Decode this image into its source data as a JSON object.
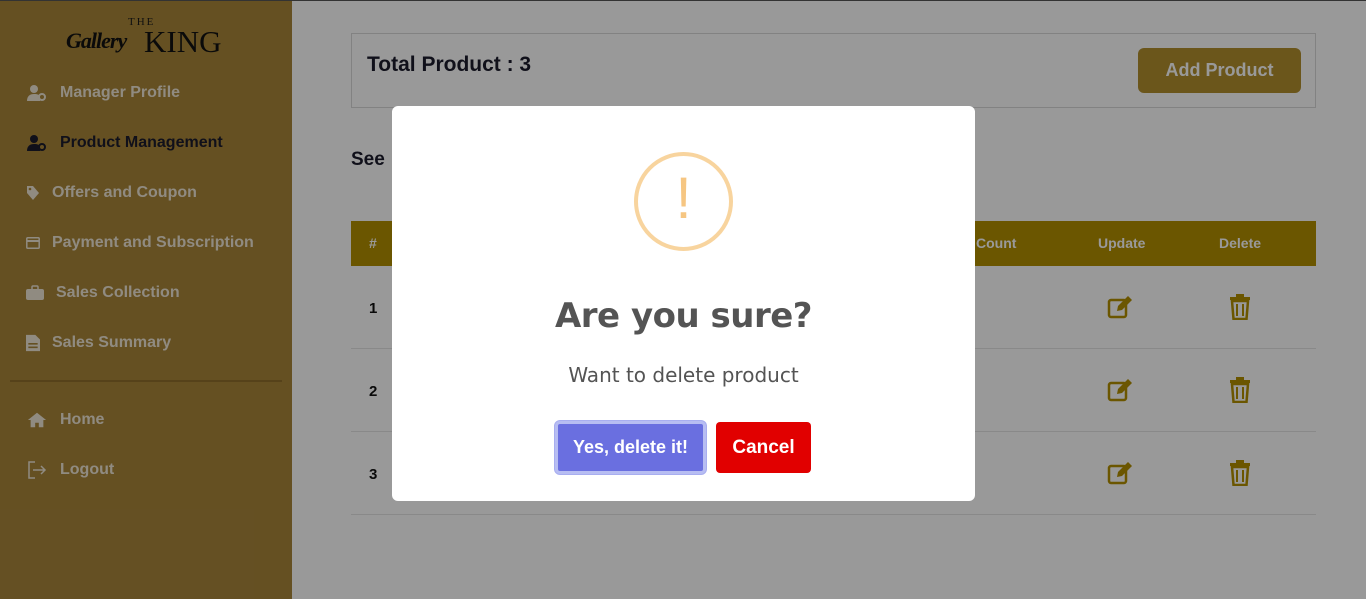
{
  "brand": {
    "the": "THE",
    "gallery": "Gallery",
    "king": "KING"
  },
  "sidebar": {
    "items": [
      {
        "label": "Manager Profile",
        "icon": "user-gear-icon"
      },
      {
        "label": "Product Management",
        "icon": "user-gear-icon",
        "active": true
      },
      {
        "label": "Offers and Coupon",
        "icon": "tag-icon"
      },
      {
        "label": "Payment and Subscription",
        "icon": "credit-card-icon"
      },
      {
        "label": "Sales Collection",
        "icon": "briefcase-icon"
      },
      {
        "label": "Sales Summary",
        "icon": "file-icon"
      },
      {
        "label": "Home",
        "icon": "home-icon"
      },
      {
        "label": "Logout",
        "icon": "logout-icon"
      }
    ]
  },
  "header": {
    "total_label": "Total Product : 3",
    "add_button": "Add Product"
  },
  "section_title": "See ",
  "table": {
    "columns": [
      "#",
      "Count",
      "Update",
      "Delete"
    ],
    "rows": [
      {
        "num": "1"
      },
      {
        "num": "2"
      },
      {
        "num": "3"
      }
    ]
  },
  "modal": {
    "icon_mark": "!",
    "title": "Are you sure?",
    "text": "Want to delete product",
    "confirm": "Yes, delete it!",
    "cancel": "Cancel"
  },
  "colors": {
    "sidebar": "#a8853a",
    "table_header": "#b38f00",
    "accent_button": "#b38f2e",
    "confirm": "#6a6fe0",
    "cancel": "#e10000",
    "warning": "#f8d49e"
  }
}
